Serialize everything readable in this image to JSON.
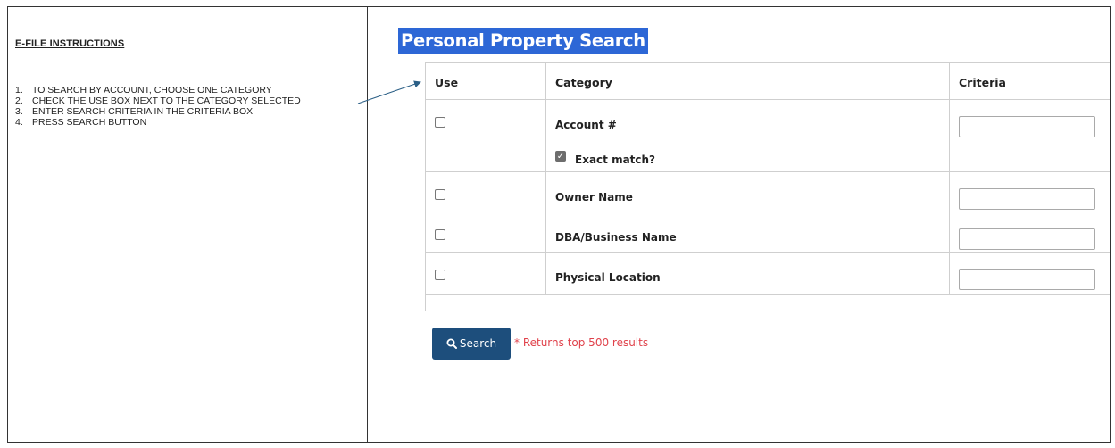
{
  "instructions": {
    "title": "E-FILE INSTRUCTIONS",
    "steps": [
      {
        "num": "1.",
        "text": "TO SEARCH BY ACCOUNT, CHOOSE ONE CATEGORY"
      },
      {
        "num": "2.",
        "text": "CHECK THE USE BOX NEXT TO THE CATEGORY SELECTED"
      },
      {
        "num": "3.",
        "text": "ENTER SEARCH CRITERIA IN THE CRITERIA BOX"
      },
      {
        "num": "4.",
        "text": "PRESS SEARCH BUTTON"
      }
    ]
  },
  "search": {
    "title": "Personal Property Search",
    "headers": {
      "use": "Use",
      "category": "Category",
      "criteria": "Criteria"
    },
    "rows": [
      {
        "category": "Account #",
        "use_checked": false,
        "criteria": ""
      },
      {
        "category": "Owner Name",
        "use_checked": false,
        "criteria": ""
      },
      {
        "category": "DBA/Business Name",
        "use_checked": false,
        "criteria": ""
      },
      {
        "category": "Physical Location",
        "use_checked": false,
        "criteria": ""
      }
    ],
    "exact_match": {
      "label": "Exact match?",
      "checked": true,
      "check_glyph": "✓"
    },
    "button_label": "Search",
    "button_icon": "search-icon",
    "results_note": "* Returns top 500 results"
  },
  "colors": {
    "title_bg": "#2d67d6",
    "button_bg": "#1d4e7c",
    "note_text": "#e0424b"
  }
}
